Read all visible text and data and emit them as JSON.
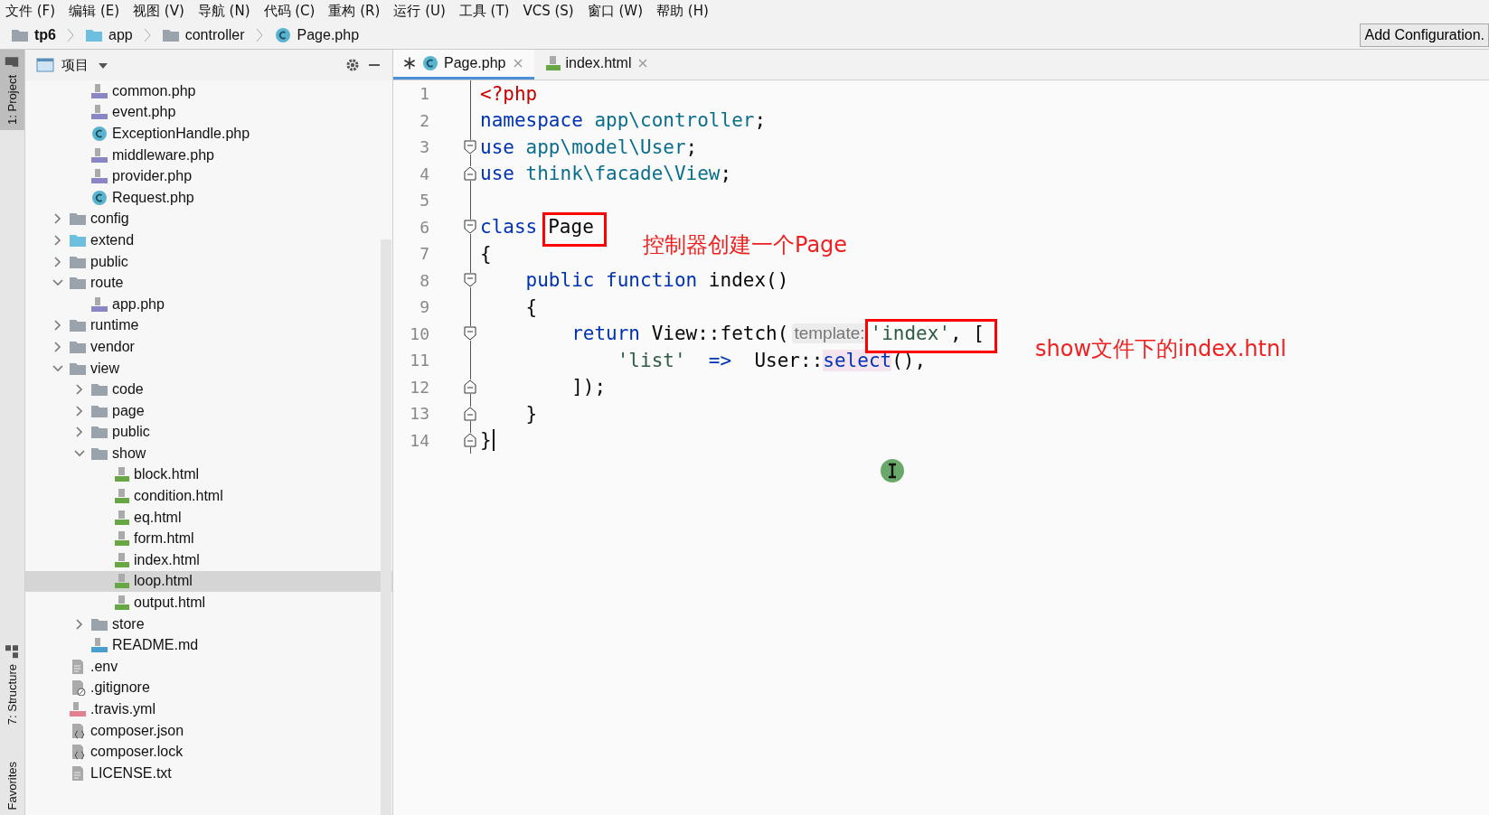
{
  "menu": [
    "文件 (F)",
    "编辑 (E)",
    "视图 (V)",
    "导航 (N)",
    "代码 (C)",
    "重构 (R)",
    "运行 (U)",
    "工具 (T)",
    "VCS (S)",
    "窗口 (W)",
    "帮助 (H)"
  ],
  "breadcrumb": [
    {
      "label": "tp6",
      "kind": "root"
    },
    {
      "label": "app",
      "kind": "source-folder"
    },
    {
      "label": "controller",
      "kind": "folder"
    },
    {
      "label": "Page.php",
      "kind": "class"
    }
  ],
  "run_config_button": "Add Configuration.",
  "side_tabs": [
    {
      "label": "1: Project",
      "selected": true
    },
    {
      "label": "7: Structure",
      "selected": false
    },
    {
      "label": "Favorites",
      "selected": false
    }
  ],
  "project_panel": {
    "title": "项目",
    "tree": [
      {
        "children": [
          {
            "label": "common.php",
            "kind": "php",
            "selected": false
          },
          {
            "label": "event.php",
            "kind": "php",
            "selected": false
          },
          {
            "label": "ExceptionHandle.php",
            "kind": "class",
            "selected": false
          },
          {
            "label": "middleware.php",
            "kind": "php",
            "selected": false
          },
          {
            "label": "provider.php",
            "kind": "php",
            "selected": false
          },
          {
            "label": "Request.php",
            "kind": "class",
            "selected": false
          }
        ]
      },
      {
        "label": "config",
        "kind": "folder",
        "expanded": false,
        "selected": false
      },
      {
        "label": "extend",
        "kind": "source-folder",
        "expanded": false,
        "selected": false
      },
      {
        "label": "public",
        "kind": "folder",
        "expanded": false,
        "selected": false
      },
      {
        "label": "route",
        "kind": "folder",
        "expanded": true,
        "selected": false,
        "children": [
          {
            "label": "app.php",
            "kind": "php",
            "selected": false
          }
        ]
      },
      {
        "label": "runtime",
        "kind": "folder",
        "expanded": false,
        "selected": false
      },
      {
        "label": "vendor",
        "kind": "folder",
        "expanded": false,
        "selected": false
      },
      {
        "label": "view",
        "kind": "folder",
        "expanded": true,
        "selected": false,
        "children": [
          {
            "label": "code",
            "kind": "folder",
            "expanded": false,
            "selected": false
          },
          {
            "label": "page",
            "kind": "folder",
            "expanded": false,
            "selected": false
          },
          {
            "label": "public",
            "kind": "folder",
            "expanded": false,
            "selected": false
          },
          {
            "label": "show",
            "kind": "folder",
            "expanded": true,
            "selected": false,
            "children": [
              {
                "label": "block.html",
                "kind": "html",
                "selected": false
              },
              {
                "label": "condition.html",
                "kind": "html",
                "selected": false
              },
              {
                "label": "eq.html",
                "kind": "html",
                "selected": false
              },
              {
                "label": "form.html",
                "kind": "html",
                "selected": false
              },
              {
                "label": "index.html",
                "kind": "html",
                "selected": false
              },
              {
                "label": "loop.html",
                "kind": "html",
                "selected": true
              },
              {
                "label": "output.html",
                "kind": "html",
                "selected": false
              }
            ]
          },
          {
            "label": "store",
            "kind": "folder",
            "expanded": false,
            "selected": false
          },
          {
            "label": "README.md",
            "kind": "md",
            "selected": false
          }
        ]
      },
      {
        "label": ".env",
        "kind": "text",
        "selected": false
      },
      {
        "label": ".gitignore",
        "kind": "ignore",
        "selected": false
      },
      {
        "label": ".travis.yml",
        "kind": "yml",
        "selected": false
      },
      {
        "label": "composer.json",
        "kind": "json",
        "selected": false
      },
      {
        "label": "composer.lock",
        "kind": "json",
        "selected": false
      },
      {
        "label": "LICENSE.txt",
        "kind": "text",
        "selected": false
      }
    ]
  },
  "editor_tabs": [
    {
      "label": "Page.php",
      "kind": "class",
      "modified": true,
      "selected": true
    },
    {
      "label": "index.html",
      "kind": "html",
      "modified": false,
      "selected": false
    }
  ],
  "code": [
    {
      "number": "1",
      "tokens": [
        {
          "text": "<?php",
          "kind": "tag"
        }
      ]
    },
    {
      "number": "2",
      "tokens": [
        {
          "text": "namespace",
          "kind": "keyword"
        },
        {
          "text": " app\\controller",
          "kind": "ns"
        },
        {
          "text": ";",
          "kind": "plain"
        }
      ]
    },
    {
      "number": "3",
      "fold_start": true,
      "tokens": [
        {
          "text": "use",
          "kind": "keyword"
        },
        {
          "text": " app\\model\\User",
          "kind": "ns"
        },
        {
          "text": ";",
          "kind": "plain"
        }
      ]
    },
    {
      "number": "4",
      "fold_end": true,
      "tokens": [
        {
          "text": "use",
          "kind": "keyword"
        },
        {
          "text": " think\\facade\\View",
          "kind": "ns"
        },
        {
          "text": ";",
          "kind": "plain"
        }
      ]
    },
    {
      "number": "5"
    },
    {
      "number": "6",
      "fold_start": true,
      "tokens": [
        {
          "text": "class",
          "kind": "keyword"
        },
        {
          "text": "Page",
          "kind": "name"
        }
      ]
    },
    {
      "number": "7",
      "tokens": [
        {
          "text": "{",
          "kind": "plain"
        }
      ]
    },
    {
      "number": "8",
      "fold_start": true,
      "tokens": [
        {
          "text": "    public function",
          "kind": "keyword"
        },
        {
          "text": " index()",
          "kind": "plain"
        }
      ]
    },
    {
      "number": "9",
      "tokens": [
        {
          "text": "    {",
          "kind": "plain"
        }
      ]
    },
    {
      "number": "10",
      "fold_start": true,
      "tokens": [
        {
          "text": "        return",
          "kind": "keyword"
        },
        {
          "text": " View::fetch(",
          "kind": "plain"
        },
        {
          "text": "template:",
          "kind": "hint"
        },
        {
          "text": "'index'",
          "kind": "string"
        },
        {
          "text": ", [",
          "kind": "plain"
        }
      ]
    },
    {
      "number": "11",
      "tokens": [
        {
          "text": "            'list'",
          "kind": "string"
        },
        {
          "text": "  =>",
          "kind": "keyword"
        },
        {
          "text": "  User::",
          "kind": "plain"
        },
        {
          "text": "select",
          "kind": "method"
        },
        {
          "text": "(),",
          "kind": "plain"
        }
      ]
    },
    {
      "number": "12",
      "fold_end": true,
      "tokens": [
        {
          "text": "        ]);",
          "kind": "plain"
        }
      ]
    },
    {
      "number": "13",
      "fold_end": true,
      "tokens": [
        {
          "text": "    }",
          "kind": "plain"
        }
      ]
    },
    {
      "number": "14",
      "fold_end": true,
      "caret": true,
      "tokens": [
        {
          "text": "}",
          "kind": "plain"
        }
      ]
    }
  ],
  "annotations": [
    {
      "kind": "box"
    },
    {
      "kind": "note",
      "text": "控制器创建一个Page"
    },
    {
      "kind": "box"
    },
    {
      "kind": "note",
      "text": "show文件下的index.htnl"
    }
  ]
}
